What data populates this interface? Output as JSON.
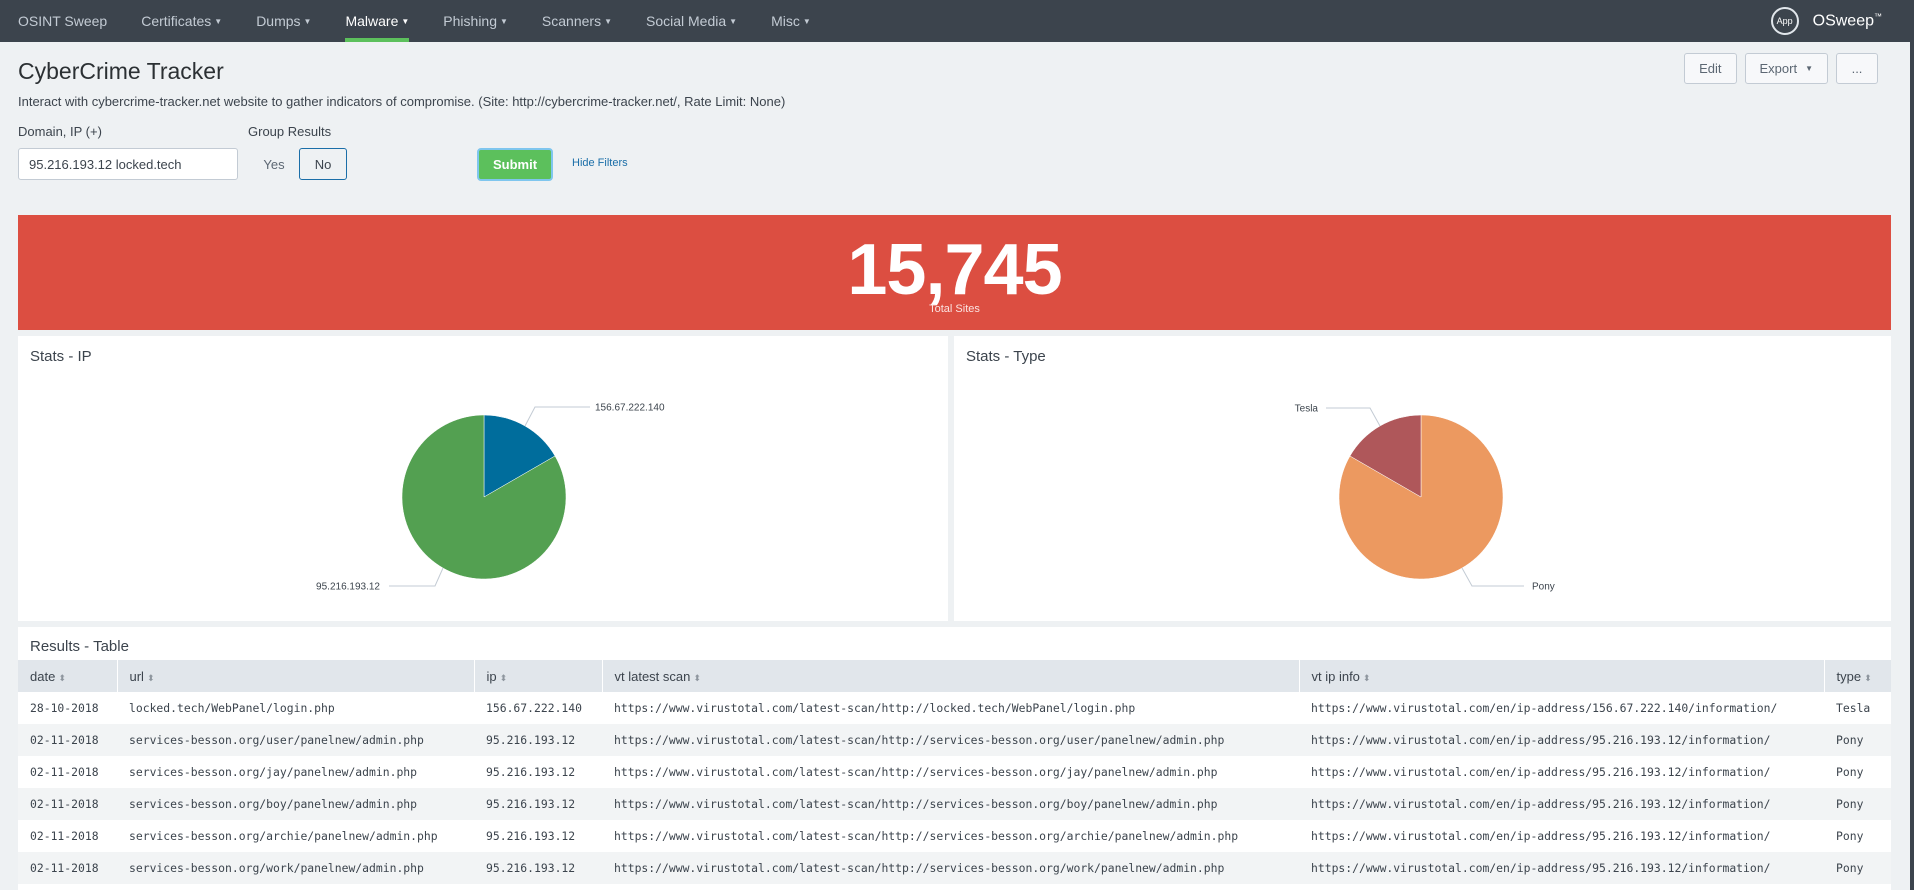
{
  "nav": {
    "items": [
      {
        "label": "OSINT Sweep",
        "dropdown": false,
        "active": false
      },
      {
        "label": "Certificates",
        "dropdown": true,
        "active": false
      },
      {
        "label": "Dumps",
        "dropdown": true,
        "active": false
      },
      {
        "label": "Malware",
        "dropdown": true,
        "active": true
      },
      {
        "label": "Phishing",
        "dropdown": true,
        "active": false
      },
      {
        "label": "Scanners",
        "dropdown": true,
        "active": false
      },
      {
        "label": "Social Media",
        "dropdown": true,
        "active": false
      },
      {
        "label": "Misc",
        "dropdown": true,
        "active": false
      }
    ],
    "app_badge": "App",
    "app_name": "OSweep",
    "trademark": "™",
    "active_color": "#5cc05c"
  },
  "header": {
    "title": "CyberCrime Tracker",
    "description": "Interact with cybercrime-tracker.net website to gather indicators of compromise. (Site: http://cybercrime-tracker.net/, Rate Limit: None)",
    "buttons": {
      "edit": "Edit",
      "export": "Export",
      "more": "..."
    }
  },
  "filters": {
    "domain_label": "Domain, IP (+)",
    "domain_value": "95.216.193.12 locked.tech",
    "group_label": "Group Results",
    "group_options": [
      "Yes",
      "No"
    ],
    "group_selected": "No",
    "submit": "Submit",
    "hide_filters": "Hide Filters"
  },
  "single_value": {
    "value": "15,745",
    "label": "Total Sites",
    "color": "#dc4e41"
  },
  "panels": {
    "ip_title": "Stats - IP",
    "type_title": "Stats - Type"
  },
  "chart_data": [
    {
      "type": "pie",
      "title": "Stats - IP",
      "categories": [
        "156.67.222.140",
        "95.216.193.12"
      ],
      "values": [
        1,
        5
      ],
      "colors": [
        "#006d9c",
        "#53a051"
      ]
    },
    {
      "type": "pie",
      "title": "Stats - Type",
      "categories": [
        "Pony",
        "Tesla"
      ],
      "values": [
        5,
        1
      ],
      "colors": [
        "#ec9960",
        "#af575a"
      ]
    }
  ],
  "table": {
    "title": "Results - Table",
    "columns": [
      "date",
      "url",
      "ip",
      "vt latest scan",
      "vt ip info",
      "type"
    ],
    "rows": [
      [
        "28-10-2018",
        "locked.tech/WebPanel/login.php",
        "156.67.222.140",
        "https://www.virustotal.com/latest-scan/http://locked.tech/WebPanel/login.php",
        "https://www.virustotal.com/en/ip-address/156.67.222.140/information/",
        "Tesla"
      ],
      [
        "02-11-2018",
        "services-besson.org/user/panelnew/admin.php",
        "95.216.193.12",
        "https://www.virustotal.com/latest-scan/http://services-besson.org/user/panelnew/admin.php",
        "https://www.virustotal.com/en/ip-address/95.216.193.12/information/",
        "Pony"
      ],
      [
        "02-11-2018",
        "services-besson.org/jay/panelnew/admin.php",
        "95.216.193.12",
        "https://www.virustotal.com/latest-scan/http://services-besson.org/jay/panelnew/admin.php",
        "https://www.virustotal.com/en/ip-address/95.216.193.12/information/",
        "Pony"
      ],
      [
        "02-11-2018",
        "services-besson.org/boy/panelnew/admin.php",
        "95.216.193.12",
        "https://www.virustotal.com/latest-scan/http://services-besson.org/boy/panelnew/admin.php",
        "https://www.virustotal.com/en/ip-address/95.216.193.12/information/",
        "Pony"
      ],
      [
        "02-11-2018",
        "services-besson.org/archie/panelnew/admin.php",
        "95.216.193.12",
        "https://www.virustotal.com/latest-scan/http://services-besson.org/archie/panelnew/admin.php",
        "https://www.virustotal.com/en/ip-address/95.216.193.12/information/",
        "Pony"
      ],
      [
        "02-11-2018",
        "services-besson.org/work/panelnew/admin.php",
        "95.216.193.12",
        "https://www.virustotal.com/latest-scan/http://services-besson.org/work/panelnew/admin.php",
        "https://www.virustotal.com/en/ip-address/95.216.193.12/information/",
        "Pony"
      ]
    ]
  }
}
